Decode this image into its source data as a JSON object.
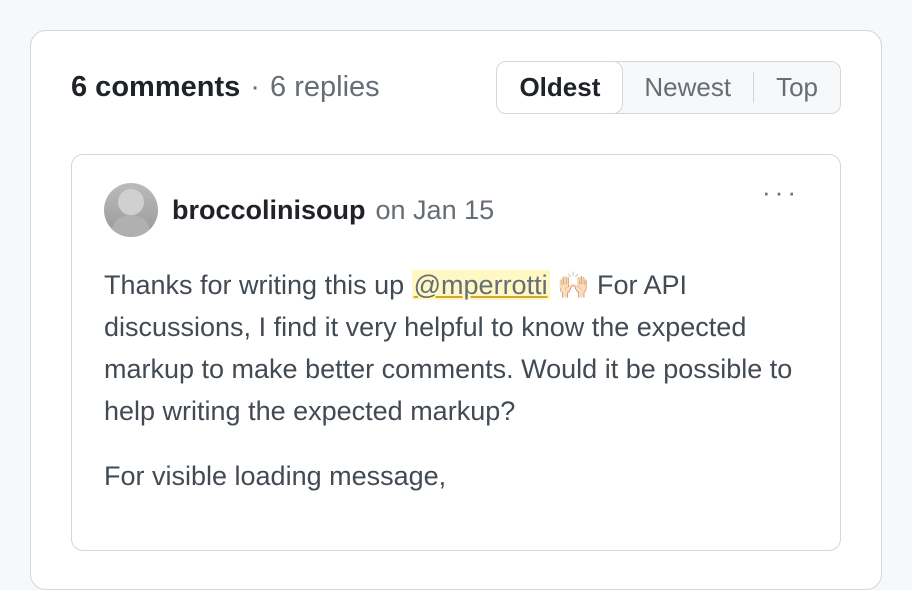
{
  "header": {
    "comments_count": "6 comments",
    "replies_count": "6 replies",
    "separator": "·"
  },
  "sort": {
    "oldest": "Oldest",
    "newest": "Newest",
    "top": "Top",
    "active": "oldest"
  },
  "comment": {
    "author": "broccolinisoup",
    "timestamp": "on Jan 15",
    "more_label": "···",
    "body_prefix": "Thanks for writing this up ",
    "mention": "@mperrotti",
    "emoji": "🙌🏻",
    "body_rest": " For API discussions, I find it very helpful to know the expected markup to make better comments. Would it be possible to help writing the expected markup?",
    "body_p2": "For visible loading message,"
  }
}
